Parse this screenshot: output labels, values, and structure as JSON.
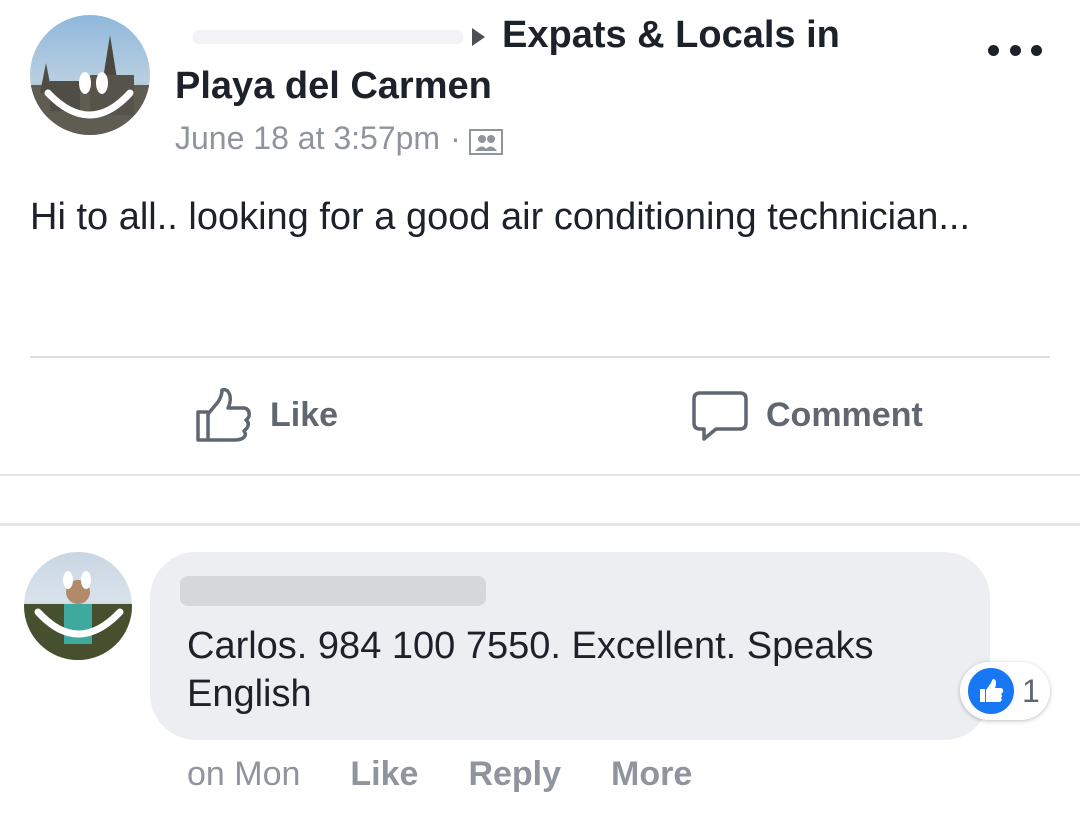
{
  "post": {
    "group_name_line1": "Expats & Locals in",
    "group_name_line2": "Playa del Carmen",
    "timestamp": "June 18 at 3:57pm",
    "separator": "·",
    "privacy_icon": "group-members-icon",
    "more_icon": "more-options-icon",
    "text": "Hi to all.. looking for a good air conditioning technician..."
  },
  "actions": {
    "like_label": "Like",
    "comment_label": "Comment"
  },
  "comment": {
    "text": "Carlos. 984 100 7550. Excellent. Speaks English",
    "reaction_count": "1",
    "time": "on Mon",
    "like_label": "Like",
    "reply_label": "Reply",
    "more_label": "More"
  },
  "colors": {
    "text": "#1d2129",
    "meta": "#90949c",
    "action": "#606770",
    "bubble": "#edeef2",
    "like_blue": "#1877f2"
  }
}
